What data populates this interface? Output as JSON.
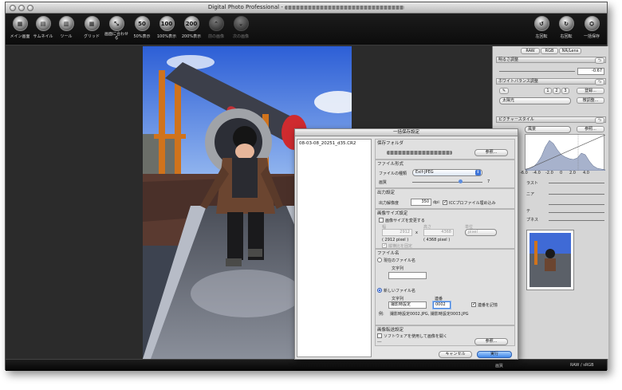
{
  "window": {
    "title": "Digital Photo Professional -"
  },
  "toolbar": {
    "left": [
      {
        "label": "メイン画面",
        "glyph": "▦"
      },
      {
        "label": "サムネイル",
        "glyph": "▤"
      },
      {
        "label": "ツール",
        "glyph": "▥"
      },
      {
        "label": "グリッド",
        "glyph": "▦"
      },
      {
        "label": "画面に合わせる",
        "glyph": "⤡"
      },
      {
        "label": "50%表示",
        "glyph": "50"
      },
      {
        "label": "100%表示",
        "glyph": "100"
      },
      {
        "label": "200%表示",
        "glyph": "200"
      },
      {
        "label": "前の画像",
        "glyph": "⌃"
      },
      {
        "label": "次の画像",
        "glyph": "⌄"
      }
    ],
    "right": [
      {
        "label": "左回転",
        "glyph": "↺"
      },
      {
        "label": "右回転",
        "glyph": "↻"
      },
      {
        "label": "一括保存",
        "glyph": "⛭"
      }
    ]
  },
  "right_panel": {
    "tabs": [
      "RAW",
      "RGB",
      "NR/Lens"
    ],
    "brightness": {
      "label": "明るさ調整",
      "value": "-0.67"
    },
    "white_balance": {
      "label": "ホワイトバランス調整",
      "presets": [
        "1",
        "2",
        "3"
      ],
      "register_label": "登録...",
      "preset_value": "太陽光",
      "fine_tune_label": "微調整..."
    },
    "picture_style": {
      "label": "ピクチャースタイル",
      "value": "風景",
      "browse_label": "参照..."
    },
    "histogram_ticks": [
      "-6.0",
      "-4.0",
      "-2.0",
      "0",
      "2.0",
      "4.0"
    ],
    "slider_labels": [
      "ラスト",
      "ニア",
      "",
      "テ",
      "プネス"
    ],
    "hist_color": "#a7b2cc"
  },
  "status": {
    "profile": "RAW / sRGB"
  },
  "file_list": {
    "items": [
      "08-03-08_20251_d35.CR2"
    ]
  },
  "dialog": {
    "title": "一括保存設定",
    "save_folder": {
      "label": "保存フォルダ",
      "browse_label": "参照..."
    },
    "file_format": {
      "label": "ファイル形式",
      "type_label": "ファイルの種類",
      "type_value": "Exif-JPEG",
      "quality_label": "画質",
      "quality_value": "7"
    },
    "output": {
      "label": "出力設定",
      "resolution_label": "出力解像度",
      "resolution_value": "350",
      "unit": "dpi",
      "icc_label": "ICCプロファイル埋め込み"
    },
    "resize": {
      "label": "画像サイズ設定",
      "resize_label": "画像サイズを変更する",
      "width_label": "幅",
      "height_label": "高さ",
      "unit_label": "単位",
      "width_value": "2912",
      "height_value": "4368",
      "unit_value": "pixel",
      "width_note": "( 2912 pixel )",
      "height_note": "( 4368 pixel )",
      "cross": "x",
      "keep_ratio_label": "縦横比を固定"
    },
    "filename": {
      "label": "ファイル名",
      "current_label": "現在のファイル名",
      "new_label": "新しいファイル名",
      "string_label": "文字列",
      "string_label2": "文字列",
      "serial_label": "連番",
      "string_value": "撮影時設定",
      "serial_value": "0002",
      "remember_label": "連番を記憶",
      "example_label": "例:",
      "example_value": "撮影時設定0002.JPG, 撮影時設定0003.JPG"
    },
    "transfer": {
      "label": "画像転送設定",
      "open_label": "ソフトウェアを使用して画像を開く",
      "dash": "---",
      "browse_label": "参照..."
    },
    "cancel_label": "キャンセル",
    "run_label": "実行"
  }
}
